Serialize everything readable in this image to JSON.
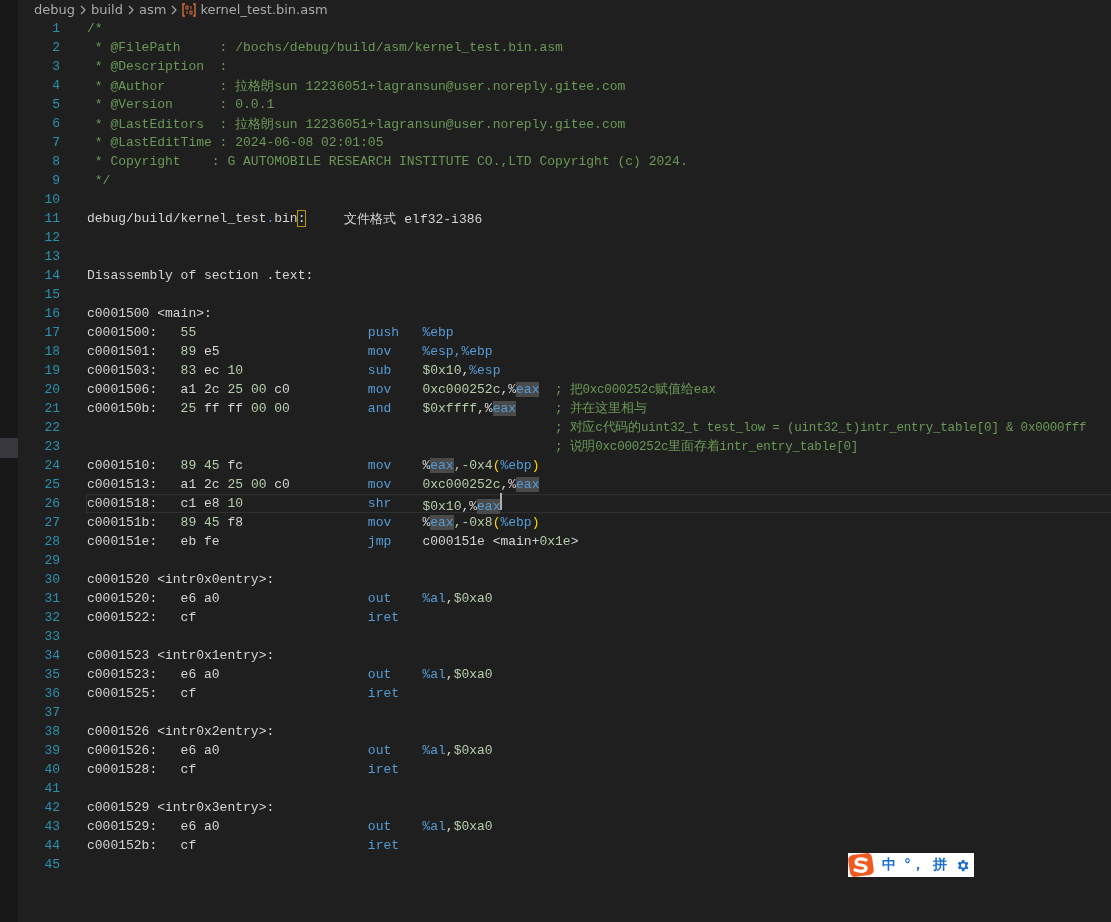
{
  "breadcrumb": {
    "folders": [
      "debug",
      "build",
      "asm"
    ],
    "file": "kernel_test.bin.asm"
  },
  "lines": [
    {
      "n": "1",
      "kind": "text",
      "current": false,
      "segs": [
        {
          "text": "/*",
          "kind": "c"
        }
      ]
    },
    {
      "n": "2",
      "kind": "text",
      "current": false,
      "segs": [
        {
          "text": " * @FilePath     : /bochs/debug/build/asm/kernel_test.bin.asm",
          "kind": "c"
        }
      ]
    },
    {
      "n": "3",
      "kind": "text",
      "current": false,
      "segs": [
        {
          "text": " * @Description  :",
          "kind": "c"
        }
      ]
    },
    {
      "n": "4",
      "kind": "text",
      "current": false,
      "segs": [
        {
          "text": " * @Author       : 拉格朗sun 12236051+lagransun@user.noreply.gitee.com",
          "kind": "c"
        }
      ]
    },
    {
      "n": "5",
      "kind": "text",
      "current": false,
      "segs": [
        {
          "text": " * @Version      : 0.0.1",
          "kind": "c"
        }
      ]
    },
    {
      "n": "6",
      "kind": "text",
      "current": false,
      "segs": [
        {
          "text": " * @LastEditors  : 拉格朗sun 12236051+lagransun@user.noreply.gitee.com",
          "kind": "c"
        }
      ]
    },
    {
      "n": "7",
      "kind": "text",
      "current": false,
      "segs": [
        {
          "text": " * @LastEditTime : 2024-06-08 02:01:05",
          "kind": "c"
        }
      ]
    },
    {
      "n": "8",
      "kind": "text",
      "current": false,
      "segs": [
        {
          "text": " * Copyright    : G AUTOMOBILE RESEARCH INSTITUTE CO.,LTD Copyright (c) 2024.",
          "kind": "c"
        }
      ]
    },
    {
      "n": "9",
      "kind": "text",
      "current": false,
      "segs": [
        {
          "text": " */",
          "kind": "c"
        }
      ]
    },
    {
      "n": "10",
      "kind": "text",
      "current": false
    },
    {
      "n": "11",
      "kind": "text",
      "current": false,
      "segs": [
        {
          "text": "debug/build/kernel_test",
          "kind": "t"
        },
        {
          "text": ".",
          "kind": "k"
        },
        {
          "text": "bin",
          "kind": "t"
        },
        {
          "text": ":",
          "kind": "m"
        },
        {
          "text": "     文件格式 elf32-i386",
          "kind": "t"
        }
      ]
    },
    {
      "n": "12",
      "kind": "text",
      "current": false
    },
    {
      "n": "13",
      "kind": "text",
      "current": false
    },
    {
      "n": "14",
      "kind": "text",
      "current": false,
      "segs": [
        {
          "text": "Disassembly of section .text:",
          "kind": "t"
        }
      ]
    },
    {
      "n": "15",
      "kind": "text",
      "current": false
    },
    {
      "n": "16",
      "kind": "text",
      "current": false,
      "segs": [
        {
          "text": "c0001500 <main>:",
          "kind": "t"
        }
      ]
    },
    {
      "n": "17",
      "kind": "instr",
      "current": false,
      "addr": "c0001500:",
      "bytes": "55",
      "op": "push",
      "args": [
        {
          "text": "%ebp",
          "kind": "k"
        }
      ]
    },
    {
      "n": "18",
      "kind": "instr",
      "current": false,
      "addr": "c0001501:",
      "bytes": "89 e5",
      "op": "mov",
      "args": [
        {
          "text": "%esp,%ebp",
          "kind": "k"
        }
      ]
    },
    {
      "n": "19",
      "kind": "instr",
      "current": false,
      "addr": "c0001503:",
      "bytes": "83 ec 10",
      "op": "sub",
      "args": [
        {
          "text": "$0x10",
          "kind": "n"
        },
        {
          "text": ",",
          "kind": "t"
        },
        {
          "text": "%esp",
          "kind": "k"
        }
      ]
    },
    {
      "n": "20",
      "kind": "instr",
      "current": false,
      "addr": "c0001506:",
      "bytes": "a1 2c 25 00 c0",
      "op": "mov",
      "args": [
        {
          "text": "0xc000252c",
          "kind": "n"
        },
        {
          "text": ",%",
          "kind": "t"
        },
        {
          "text": "eax",
          "kind": "h"
        }
      ],
      "comment": "; 把0xc000252c赋值给eax"
    },
    {
      "n": "21",
      "kind": "instr",
      "current": false,
      "addr": "c000150b:",
      "bytes": "25 ff ff 00 00",
      "op": "and",
      "args": [
        {
          "text": "$0xffff",
          "kind": "n"
        },
        {
          "text": ",%",
          "kind": "t"
        },
        {
          "text": "eax",
          "kind": "h"
        }
      ],
      "comment": "; 并在这里相与"
    },
    {
      "n": "22",
      "kind": "instr",
      "current": false,
      "comment": "; 对应c代码的uint32_t test_low = (uint32_t)intr_entry_table[0] & 0x0000fff"
    },
    {
      "n": "23",
      "kind": "instr",
      "current": false,
      "comment": "; 说明0xc000252c里面存着intr_entry_table[0]"
    },
    {
      "n": "24",
      "kind": "instr",
      "current": false,
      "addr": "c0001510:",
      "bytes": "89 45 fc",
      "op": "mov",
      "args": [
        {
          "text": "%",
          "kind": "t"
        },
        {
          "text": "eax",
          "kind": "h"
        },
        {
          "text": ",-0x4",
          "kind": "n"
        },
        {
          "text": "(",
          "kind": "b"
        },
        {
          "text": "%ebp",
          "kind": "k"
        },
        {
          "text": ")",
          "kind": "b"
        }
      ]
    },
    {
      "n": "25",
      "kind": "instr",
      "current": false,
      "addr": "c0001513:",
      "bytes": "a1 2c 25 00 c0",
      "op": "mov",
      "args": [
        {
          "text": "0xc000252c",
          "kind": "n"
        },
        {
          "text": ",%",
          "kind": "t"
        },
        {
          "text": "eax",
          "kind": "h"
        }
      ]
    },
    {
      "n": "26",
      "kind": "instr",
      "current": true,
      "addr": "c0001518:",
      "bytes": "c1 e8 10",
      "op": "shr",
      "args": [
        {
          "text": "$0x10",
          "kind": "n"
        },
        {
          "text": ",%",
          "kind": "t"
        },
        {
          "text": "eax",
          "kind": "h"
        }
      ]
    },
    {
      "n": "27",
      "kind": "instr",
      "current": false,
      "addr": "c000151b:",
      "bytes": "89 45 f8",
      "op": "mov",
      "args": [
        {
          "text": "%",
          "kind": "t"
        },
        {
          "text": "eax",
          "kind": "h"
        },
        {
          "text": ",-0x8",
          "kind": "n"
        },
        {
          "text": "(",
          "kind": "b"
        },
        {
          "text": "%ebp",
          "kind": "k"
        },
        {
          "text": ")",
          "kind": "b"
        }
      ]
    },
    {
      "n": "28",
      "kind": "instr",
      "current": false,
      "addr": "c000151e:",
      "bytes": "eb fe",
      "op": "jmp",
      "args": [
        {
          "text": "c000151e <main+",
          "kind": "t"
        },
        {
          "text": "0x1e",
          "kind": "n"
        },
        {
          "text": ">",
          "kind": "t"
        }
      ]
    },
    {
      "n": "29",
      "kind": "text",
      "current": false
    },
    {
      "n": "30",
      "kind": "text",
      "current": false,
      "segs": [
        {
          "text": "c0001520 <intr0x0entry>:",
          "kind": "t"
        }
      ]
    },
    {
      "n": "31",
      "kind": "instr",
      "current": false,
      "addr": "c0001520:",
      "bytes": "e6 a0",
      "op": "out",
      "args": [
        {
          "text": "%al",
          "kind": "k"
        },
        {
          "text": ",",
          "kind": "t"
        },
        {
          "text": "$0xa0",
          "kind": "n"
        }
      ]
    },
    {
      "n": "32",
      "kind": "instr",
      "current": false,
      "addr": "c0001522:",
      "bytes": "cf",
      "op": "iret"
    },
    {
      "n": "33",
      "kind": "text",
      "current": false
    },
    {
      "n": "34",
      "kind": "text",
      "current": false,
      "segs": [
        {
          "text": "c0001523 <intr0x1entry>:",
          "kind": "t"
        }
      ]
    },
    {
      "n": "35",
      "kind": "instr",
      "current": false,
      "addr": "c0001523:",
      "bytes": "e6 a0",
      "op": "out",
      "args": [
        {
          "text": "%al",
          "kind": "k"
        },
        {
          "text": ",",
          "kind": "t"
        },
        {
          "text": "$0xa0",
          "kind": "n"
        }
      ]
    },
    {
      "n": "36",
      "kind": "instr",
      "current": false,
      "addr": "c0001525:",
      "bytes": "cf",
      "op": "iret"
    },
    {
      "n": "37",
      "kind": "text",
      "current": false
    },
    {
      "n": "38",
      "kind": "text",
      "current": false,
      "segs": [
        {
          "text": "c0001526 <intr0x2entry>:",
          "kind": "t"
        }
      ]
    },
    {
      "n": "39",
      "kind": "instr",
      "current": false,
      "addr": "c0001526:",
      "bytes": "e6 a0",
      "op": "out",
      "args": [
        {
          "text": "%al",
          "kind": "k"
        },
        {
          "text": ",",
          "kind": "t"
        },
        {
          "text": "$0xa0",
          "kind": "n"
        }
      ]
    },
    {
      "n": "40",
      "kind": "instr",
      "current": false,
      "addr": "c0001528:",
      "bytes": "cf",
      "op": "iret"
    },
    {
      "n": "41",
      "kind": "text",
      "current": false
    },
    {
      "n": "42",
      "kind": "text",
      "current": false,
      "segs": [
        {
          "text": "c0001529 <intr0x3entry>:",
          "kind": "t"
        }
      ]
    },
    {
      "n": "43",
      "kind": "instr",
      "current": false,
      "addr": "c0001529:",
      "bytes": "e6 a0",
      "op": "out",
      "args": [
        {
          "text": "%al",
          "kind": "k"
        },
        {
          "text": ",",
          "kind": "t"
        },
        {
          "text": "$0xa0",
          "kind": "n"
        }
      ]
    },
    {
      "n": "44",
      "kind": "instr",
      "current": false,
      "addr": "c000152b:",
      "bytes": "cf",
      "op": "iret"
    },
    {
      "n": "45",
      "kind": "text",
      "current": false
    }
  ],
  "ime": {
    "items": [
      "中",
      "°，",
      "拼"
    ]
  }
}
